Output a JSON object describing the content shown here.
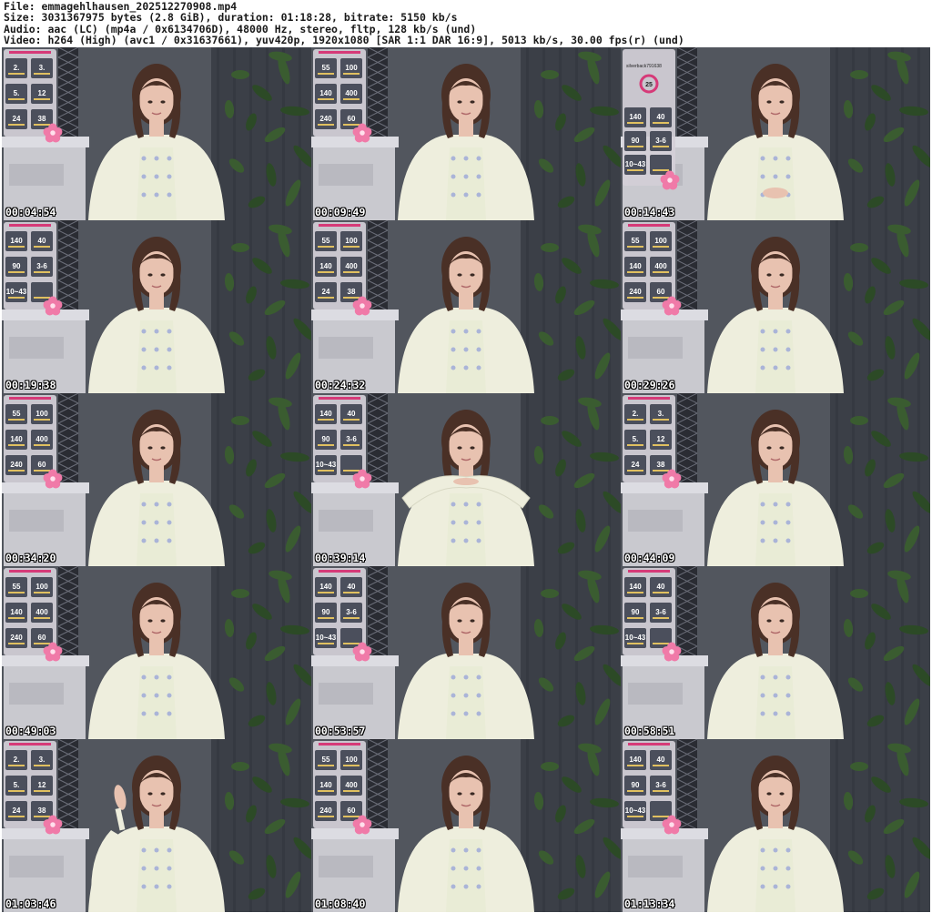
{
  "header": {
    "file_line": "File: emmagehlhausen_202512270908.mp4",
    "size_line": "Size: 3031367975 bytes (2.8 GiB), duration: 01:18:28, bitrate: 5150 kb/s",
    "audio_line": "Audio: aac (LC) (mp4a / 0x6134706D), 48000 Hz, stereo, fltp, 128 kb/s (und)",
    "video_line": "Video: h264 (High) (avc1 / 0x31637661), yuv420p, 1920x1080 [SAR 1:1 DAR 16:9], 5013 kb/s, 30.00 fps(r) (und)"
  },
  "thumbnails": [
    {
      "timestamp": "00:04:54",
      "panel": "A",
      "tiles": [
        [
          "2.",
          "3."
        ],
        [
          "5.",
          "12"
        ],
        [
          "24",
          "38"
        ]
      ],
      "pose": "down"
    },
    {
      "timestamp": "00:09:49",
      "panel": "B",
      "tiles": [
        [
          "55",
          "100"
        ],
        [
          "140",
          "400"
        ],
        [
          "240",
          "60"
        ]
      ],
      "pose": "down"
    },
    {
      "timestamp": "00:14:43",
      "panel": "C",
      "tiles": [
        [
          "140",
          "40"
        ],
        [
          "90",
          "3-6"
        ],
        [
          "10~43",
          ""
        ]
      ],
      "pose": "hands",
      "overlay_text": "silverback791638",
      "badge": "25"
    },
    {
      "timestamp": "00:19:38",
      "panel": "C",
      "tiles": [
        [
          "140",
          "40"
        ],
        [
          "90",
          "3-6"
        ],
        [
          "10~43",
          ""
        ]
      ],
      "pose": "down"
    },
    {
      "timestamp": "00:24:32",
      "panel": "A",
      "tiles": [
        [
          "55",
          "100"
        ],
        [
          "140",
          "400"
        ],
        [
          "24",
          "38"
        ]
      ],
      "pose": "down"
    },
    {
      "timestamp": "00:29:26",
      "panel": "B",
      "tiles": [
        [
          "55",
          "100"
        ],
        [
          "140",
          "400"
        ],
        [
          "240",
          "60"
        ]
      ],
      "pose": "down"
    },
    {
      "timestamp": "00:34:20",
      "panel": "B",
      "tiles": [
        [
          "55",
          "100"
        ],
        [
          "140",
          "400"
        ],
        [
          "240",
          "60"
        ]
      ],
      "pose": "down"
    },
    {
      "timestamp": "00:39:14",
      "panel": "C",
      "tiles": [
        [
          "140",
          "40"
        ],
        [
          "90",
          "3-6"
        ],
        [
          "10~43",
          ""
        ]
      ],
      "pose": "arms"
    },
    {
      "timestamp": "00:44:09",
      "panel": "A",
      "tiles": [
        [
          "2.",
          "3."
        ],
        [
          "5.",
          "12"
        ],
        [
          "24",
          "38"
        ]
      ],
      "pose": "down"
    },
    {
      "timestamp": "00:49:03",
      "panel": "B",
      "tiles": [
        [
          "55",
          "100"
        ],
        [
          "140",
          "400"
        ],
        [
          "240",
          "60"
        ]
      ],
      "pose": "down"
    },
    {
      "timestamp": "00:53:57",
      "panel": "C",
      "tiles": [
        [
          "140",
          "40"
        ],
        [
          "90",
          "3-6"
        ],
        [
          "10~43",
          ""
        ]
      ],
      "pose": "down"
    },
    {
      "timestamp": "00:58:51",
      "panel": "C",
      "tiles": [
        [
          "140",
          "40"
        ],
        [
          "90",
          "3-6"
        ],
        [
          "10~43",
          ""
        ]
      ],
      "pose": "down"
    },
    {
      "timestamp": "01:03:46",
      "panel": "A",
      "tiles": [
        [
          "2.",
          "3."
        ],
        [
          "5.",
          "12"
        ],
        [
          "24",
          "38"
        ]
      ],
      "pose": "hand-up"
    },
    {
      "timestamp": "01:08:40",
      "panel": "B",
      "tiles": [
        [
          "55",
          "100"
        ],
        [
          "140",
          "400"
        ],
        [
          "240",
          "60"
        ]
      ],
      "pose": "down"
    },
    {
      "timestamp": "01:13:34",
      "panel": "C",
      "tiles": [
        [
          "140",
          "40"
        ],
        [
          "90",
          "3-6"
        ],
        [
          "10~43",
          ""
        ]
      ],
      "pose": "down"
    }
  ],
  "colors": {
    "wall": "#52565e",
    "curtain": "#3b3f47",
    "plant": "#2c4a26",
    "desk": "#c9c9cf",
    "cardigan": "#eeeedd",
    "hair": "#4a3026",
    "skin": "#e8c2b0",
    "overlay_bg": "#d4cfd8",
    "overlay_tile": "#4b4f5c",
    "flower": "#f07aa8"
  }
}
